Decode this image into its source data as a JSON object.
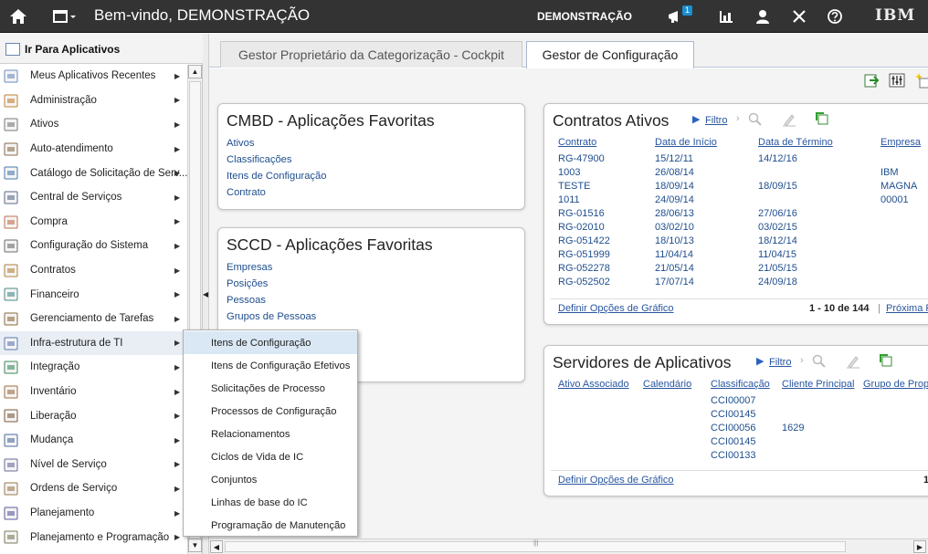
{
  "topbar": {
    "welcome": "Bem-vindo, DEMONSTRAÇÃO",
    "user": "DEMONSTRAÇÃO",
    "notifications_count": "1",
    "brand": "IBM"
  },
  "left_panel": {
    "title": "Ir Para Aplicativos",
    "items": [
      {
        "label": "Meus Aplicativos Recentes",
        "icon": "recent-apps-icon"
      },
      {
        "label": "Administração",
        "icon": "administration-icon"
      },
      {
        "label": "Ativos",
        "icon": "assets-icon"
      },
      {
        "label": "Auto-atendimento",
        "icon": "self-service-icon"
      },
      {
        "label": "Catálogo de Solicitação de Serv...",
        "icon": "service-catalog-icon"
      },
      {
        "label": "Central de Serviços",
        "icon": "service-desk-icon"
      },
      {
        "label": "Compra",
        "icon": "purchasing-icon"
      },
      {
        "label": "Configuração do Sistema",
        "icon": "system-config-icon"
      },
      {
        "label": "Contratos",
        "icon": "contracts-icon"
      },
      {
        "label": "Financeiro",
        "icon": "financial-icon"
      },
      {
        "label": "Gerenciamento de Tarefas",
        "icon": "task-management-icon"
      },
      {
        "label": "Infra-estrutura de TI",
        "icon": "it-infrastructure-icon"
      },
      {
        "label": "Integração",
        "icon": "integration-icon"
      },
      {
        "label": "Inventário",
        "icon": "inventory-icon"
      },
      {
        "label": "Liberação",
        "icon": "release-icon"
      },
      {
        "label": "Mudança",
        "icon": "change-icon"
      },
      {
        "label": "Nível de Serviço",
        "icon": "service-level-icon"
      },
      {
        "label": "Ordens de Serviço",
        "icon": "work-orders-icon"
      },
      {
        "label": "Planejamento",
        "icon": "planning-icon"
      },
      {
        "label": "Planejamento e Programação",
        "icon": "scheduling-icon"
      }
    ]
  },
  "flyout": {
    "items": [
      "Itens de Configuração",
      "Itens de Configuração Efetivos",
      "Solicitações de Processo",
      "Processos de Configuração",
      "Relacionamentos",
      "Ciclos de Vida de IC",
      "Conjuntos",
      "Linhas de base do IC",
      "Programação de Manutenção"
    ]
  },
  "tabs": [
    {
      "label": "Gestor Proprietário da Categorização - Cockpit"
    },
    {
      "label": "Gestor de Configuração"
    }
  ],
  "cmbd": {
    "title": "CMBD - Aplicações Favoritas",
    "links": [
      "Ativos",
      "Classificações",
      "Itens de Configuração",
      "Contrato"
    ]
  },
  "sccd": {
    "title": "SCCD - Aplicações Favoritas",
    "links": [
      "Empresas",
      "Posições",
      "Pessoas",
      "Grupos de Pessoas"
    ]
  },
  "contracts": {
    "title": "Contratos Ativos",
    "filter": "Filtro",
    "headers": [
      "Contrato",
      "Data de Início",
      "Data de Término",
      "Empresa"
    ],
    "rows": [
      [
        "RG-47900",
        "15/12/11",
        "14/12/16",
        ""
      ],
      [
        "1003",
        "26/08/14",
        "",
        "IBM"
      ],
      [
        "TESTE",
        "18/09/14",
        "18/09/15",
        "MAGNA"
      ],
      [
        "1011",
        "24/09/14",
        "",
        "00001"
      ],
      [
        "RG-01516",
        "28/06/13",
        "27/06/16",
        ""
      ],
      [
        "RG-02010",
        "03/02/10",
        "03/02/15",
        ""
      ],
      [
        "RG-051422",
        "18/10/13",
        "18/12/14",
        ""
      ],
      [
        "RG-051999",
        "11/04/14",
        "11/04/15",
        ""
      ],
      [
        "RG-052278",
        "21/05/14",
        "21/05/15",
        ""
      ],
      [
        "RG-052502",
        "17/07/14",
        "24/09/18",
        ""
      ]
    ],
    "chart_options": "Definir Opções de Gráfico",
    "pagination": "1 - 10 de 144",
    "separator": "|",
    "next": "Próxima P"
  },
  "servers": {
    "title": "Servidores de Aplicativos",
    "filter": "Filtro",
    "headers": [
      "Ativo Associado",
      "Calendário",
      "Classificação",
      "Cliente Principal",
      "Grupo de Propr"
    ],
    "rows": [
      [
        "",
        "",
        "CCI00007",
        ""
      ],
      [
        "",
        "",
        "CCI00145",
        ""
      ],
      [
        "",
        "",
        "CCI00056",
        "1629"
      ],
      [
        "",
        "",
        "CCI00145",
        ""
      ],
      [
        "",
        "",
        "CCI00133",
        ""
      ]
    ],
    "chart_options": "Definir Opções de Gráfico",
    "pagination": "1"
  }
}
